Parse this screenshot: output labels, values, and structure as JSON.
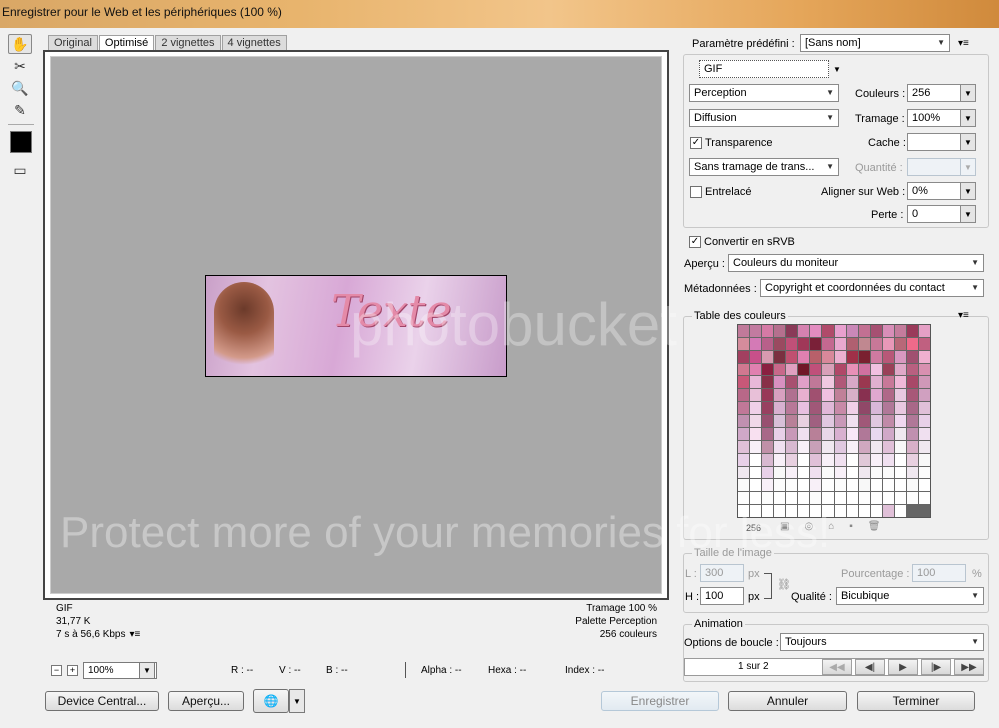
{
  "window": {
    "title": "Enregistrer pour le Web et les périphériques (100 %)"
  },
  "tools": [
    {
      "icon": "hand-icon"
    },
    {
      "icon": "slice-select-icon"
    },
    {
      "icon": "zoom-icon"
    },
    {
      "icon": "eyedropper-icon"
    },
    {
      "icon": "eyedropper-color-icon"
    },
    {
      "icon": "toggle-slices-icon"
    }
  ],
  "tabs": [
    "Original",
    "Optimisé",
    "2 vignettes",
    "4 vignettes"
  ],
  "preview": {
    "text": "Texte"
  },
  "info": {
    "format": "GIF",
    "size": "31,77 K",
    "time": "7 s à 56,6 Kbps",
    "dither": "Tramage 100 %",
    "palette": "Palette Perception",
    "colors": "256 couleurs"
  },
  "statusbar": {
    "zoom": "100%",
    "r": "R : --",
    "g": "V : --",
    "b": "B : --",
    "alpha": "Alpha : --",
    "hexa": "Hexa : --",
    "index": "Index : --"
  },
  "buttons": {
    "device_central": "Device Central...",
    "apercu": "Aperçu...",
    "enregistrer": "Enregistrer",
    "annuler": "Annuler",
    "terminer": "Terminer"
  },
  "settings": {
    "preset_label": "Paramètre prédéfini :",
    "preset_value": "[Sans nom]",
    "format": "GIF",
    "reduction": "Perception",
    "dither_algo": "Diffusion",
    "transparency_label": "Transparence",
    "matte_dither": "Sans tramage de trans...",
    "interlaced_label": "Entrelacé",
    "colors_label": "Couleurs :",
    "colors_value": "256",
    "dither_label": "Tramage :",
    "dither_value": "100%",
    "matte_label": "Cache :",
    "matte_value": "",
    "amount_label": "Quantité :",
    "websnap_label": "Aligner sur Web :",
    "websnap_value": "0%",
    "lossy_label": "Perte :",
    "lossy_value": "0",
    "srgb_label": "Convertir en sRVB",
    "preview_label": "Aperçu :",
    "preview_value": "Couleurs du moniteur",
    "metadata_label": "Métadonnées :",
    "metadata_value": "Copyright et coordonnées du contact"
  },
  "color_table": {
    "title": "Table des couleurs",
    "count": "256",
    "colors": [
      "#c07a9a",
      "#c27ba0",
      "#d57aa5",
      "#b5708e",
      "#8a3a58",
      "#d682b0",
      "#e38cc0",
      "#b04a6a",
      "#e8a0cf",
      "#ca88b8",
      "#c27092",
      "#a65072",
      "#d88eb8",
      "#c47c9c",
      "#9a3a5a",
      "#e5a0c5",
      "#d48c9c",
      "#d47ab6",
      "#b8608a",
      "#9a4a60",
      "#c05078",
      "#a03858",
      "#7a2038",
      "#c46890",
      "#e9a8cf",
      "#b06070",
      "#c08890",
      "#c87898",
      "#e898b8",
      "#b86878",
      "#ef6a8a",
      "#c06080",
      "#a24060",
      "#c8508a",
      "#d89ab0",
      "#7a3040",
      "#c05070",
      "#e080b0",
      "#b8606a",
      "#d8889a",
      "#ecb0d0",
      "#a03048",
      "#7a2030",
      "#cf7aa0",
      "#b85878",
      "#d898c0",
      "#a05070",
      "#f0b0d0",
      "#d07890",
      "#e080b0",
      "#8a2040",
      "#c8688a",
      "#e0a0c0",
      "#701828",
      "#c0507a",
      "#d8a0b8",
      "#b04868",
      "#e890b8",
      "#d070a0",
      "#f0c0e0",
      "#9a4058",
      "#e0a8c8",
      "#b86080",
      "#d890b0",
      "#c85878",
      "#e8b8d8",
      "#883048",
      "#d890c0",
      "#a85070",
      "#e0a0c8",
      "#c07898",
      "#f0c8e0",
      "#b05878",
      "#d8a8c8",
      "#9a3850",
      "#e0b0d0",
      "#c87898",
      "#f0b8d8",
      "#a84868",
      "#d098b8",
      "#b86888",
      "#e8c0d8",
      "#983858",
      "#d8a0c0",
      "#b07090",
      "#e8b0d0",
      "#a05070",
      "#f0c0e0",
      "#c08098",
      "#d8b0c8",
      "#883050",
      "#e0a8d0",
      "#b06888",
      "#e8c8e0",
      "#a85878",
      "#d0a0c0",
      "#c07898",
      "#f0d0e8",
      "#984060",
      "#d8b0d0",
      "#b87898",
      "#e8c0e0",
      "#a05878",
      "#e0b8d8",
      "#c88aa8",
      "#f0d0e8",
      "#904868",
      "#d8b8d8",
      "#b07898",
      "#e8c8e0",
      "#a86888",
      "#e0c0d8",
      "#c090b0",
      "#f0d8e8",
      "#985070",
      "#d8c0d8",
      "#b88098",
      "#e8d0e0",
      "#a06080",
      "#e0c8e0",
      "#c898b8",
      "#f0e0f0",
      "#a05878",
      "#e0c8e0",
      "#c08aa8",
      "#f0d8f0",
      "#b07898",
      "#e8d0e8",
      "#d0a8c8",
      "#f8e0f0",
      "#a86888",
      "#e8d0e8",
      "#c898b8",
      "#f0e0f0",
      "#b88098",
      "#e8d8e8",
      "#d8b0d0",
      "#f8e8f8",
      "#b07898",
      "#e8d8f0",
      "#d0a8c8",
      "#f0e8f0",
      "#c090b0",
      "#f0e0f0",
      "#e0c0d8",
      "#f8f0f8",
      "#c090a8",
      "#f0e0f0",
      "#d8b8d0",
      "#f8f0f8",
      "#c8a0b8",
      "#f0e8f0",
      "#e0c8e0",
      "#f8f0f8",
      "#d0a8c0",
      "#f0e8f0",
      "#e0c0d8",
      "#f8f8f8",
      "#d8b0c8",
      "#f0e8f0",
      "#e8d0e8",
      "#ffffff",
      "#d8b8d0",
      "#f8f0f8",
      "#e8d0e0",
      "#ffffff",
      "#e0c0d8",
      "#f8f0f8",
      "#f0e0f0",
      "#ffffff",
      "#e0c8d8",
      "#f8f0f8",
      "#f0e0f0",
      "#ffffff",
      "#e8d0e0",
      "#f8f8f8",
      "#f0e8f0",
      "#ffffff",
      "#e8d0e8",
      "#f8f8f8",
      "#f8f0f8",
      "#ffffff",
      "#f0e0f0",
      "#fafafa",
      "#f8f0f8",
      "#ffffff",
      "#f0e8f0",
      "#fafafa",
      "#fafafa",
      "#ffffff",
      "#f0e8f0",
      "#fcfcfc",
      "#fafafa",
      "#ffffff",
      "#f8f0f8",
      "#fcfcfc",
      "#fcfcfc",
      "#ffffff",
      "#f8f0f8",
      "#fefefe",
      "#fcfcfc",
      "#ffffff",
      "#f8f8f8",
      "#fefefe",
      "#fefefe",
      "#ffffff",
      "#fafafa",
      "#ffffff",
      "#fefefe",
      "#ffffff",
      "#fcfcfc",
      "#ffffff",
      "#ffffff",
      "#ffffff",
      "#fcfcfc",
      "#ffffff",
      "#ffffff",
      "#ffffff",
      "#fefefe",
      "#ffffff",
      "#ffffff",
      "#ffffff",
      "#fefefe",
      "#ffffff",
      "#ffffff",
      "#ffffff",
      "#ffffff",
      "#ffffff",
      "#ffffff",
      "#ffffff",
      "#ffffff",
      "#ffffff",
      "#ffffff",
      "#ffffff",
      "#ffffff",
      "#ffffff",
      "#e0c0d8",
      "#ffffff"
    ]
  },
  "image_size": {
    "title": "Taille de l'image",
    "w_label": "L :",
    "w_value": "300",
    "h_label": "H :",
    "h_value": "100",
    "unit": "px",
    "percent_label": "Pourcentage :",
    "percent_value": "100",
    "percent_unit": "%",
    "quality_label": "Qualité :",
    "quality_value": "Bicubique"
  },
  "animation": {
    "title": "Animation",
    "loop_label": "Options de boucle :",
    "loop_value": "Toujours",
    "frame": "1 sur 2"
  },
  "watermark": {
    "big": "Protect more of your memories for less!",
    "logo": "photobucket"
  }
}
